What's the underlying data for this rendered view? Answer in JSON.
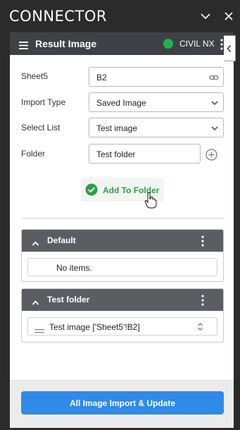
{
  "app": {
    "title": "CONNECTOR"
  },
  "titlebar": {
    "collapse_icon": "chevron-down-icon",
    "close_icon": "close-icon"
  },
  "panel": {
    "title": "Result Image",
    "menu_icon": "hamburger-icon",
    "status": {
      "label": "CIVIL NX",
      "color": "#21b34a"
    },
    "side_toggle_icon": "chevron-left-icon"
  },
  "form": {
    "sheet": {
      "label": "Sheet5",
      "value": "B2",
      "icon": "link-icon"
    },
    "import_type": {
      "label": "Import Type",
      "value": "Saved Image"
    },
    "select_list": {
      "label": "Select List",
      "value": "Test image"
    },
    "folder": {
      "label": "Folder",
      "value": "Test folder",
      "add_icon": "plus-circle-icon"
    }
  },
  "add_folder_button": {
    "label": "Add To Folder",
    "icon": "check-circle-icon",
    "color": "#2e9e4a"
  },
  "groups": [
    {
      "title": "Default",
      "empty_text": "No items.",
      "items": []
    },
    {
      "title": "Test folder",
      "items": [
        {
          "label": "Test image ['Sheet5'!B2]"
        }
      ]
    }
  ],
  "footer": {
    "button_label": "All Image Import & Update",
    "button_color": "#2f8ae8"
  }
}
